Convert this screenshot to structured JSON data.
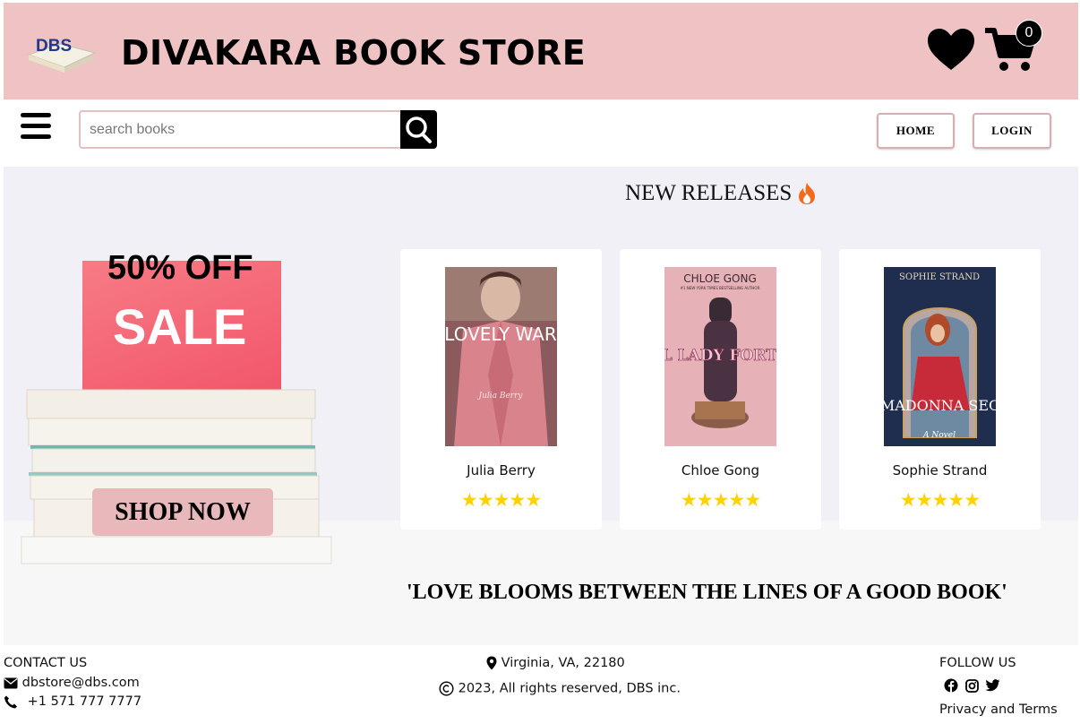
{
  "header": {
    "logo_text": "DBS",
    "title": "DIVAKARA BOOK STORE",
    "cart_count": "0",
    "icons": [
      "heart-icon",
      "cart-icon"
    ]
  },
  "nav": {
    "search_placeholder": "search books",
    "home_label": "HOME",
    "login_label": "LOGIN"
  },
  "hero": {
    "sale_discount": "50% OFF",
    "sale_word": "SALE",
    "shop_now_label": "SHOP NOW",
    "section_title": "NEW RELEASES",
    "books": [
      {
        "author": "Julia Berry",
        "cover_title": "LOVELY WAR",
        "cover_author": "Julia Berry",
        "rating": 5,
        "stars": "★★★★★"
      },
      {
        "author": "Chloe Gong",
        "cover_title": "FOUL LADY FORTUNE",
        "cover_author": "CHLOE GONG",
        "cover_tag": "#1 NEW YORK TIMES BESTSELLING AUTHOR",
        "rating": 5,
        "stars": "★★★★★"
      },
      {
        "author": "Sophie Strand",
        "cover_title": "The MADONNA SECRET",
        "cover_author": "SOPHIE STRAND",
        "cover_sub": "A Novel",
        "rating": 5,
        "stars": "★★★★★"
      }
    ],
    "quote": "'LOVE BLOOMS BETWEEN THE LINES OF A GOOD BOOK'"
  },
  "footer": {
    "contact_heading": "CONTACT US",
    "email": "dbstore@dbs.com",
    "phone": "+1 571 777 7777",
    "location": "Virginia, VA, 22180",
    "copyright": "2023, All rights reserved, DBS inc.",
    "follow_heading": "FOLLOW US",
    "privacy": "Privacy and Terms",
    "social_icons": [
      "facebook-icon",
      "instagram-icon",
      "twitter-icon"
    ]
  },
  "colors": {
    "header_bg": "#efc3c4",
    "hero_bg": "#f1f0f7",
    "star": "#ffd200",
    "shop_now_bg": "#e8b8bb"
  }
}
